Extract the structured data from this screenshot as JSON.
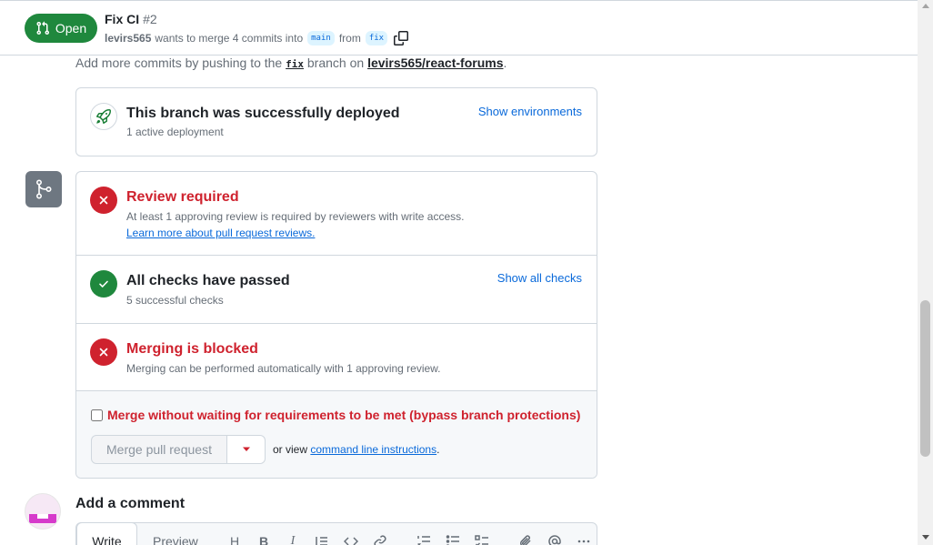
{
  "header": {
    "state": "Open",
    "title": "Fix CI",
    "number": "#2",
    "author": "levirs565",
    "meta_middle": "wants to merge 4 commits into",
    "base_branch": "main",
    "from_text": "from",
    "head_branch": "fix"
  },
  "commit_hint": {
    "prefix": "Add more commits by pushing to the",
    "branch": "fix",
    "middle": "branch on",
    "repo": "levirs565/react-forums",
    "suffix": "."
  },
  "deployment": {
    "title": "This branch was successfully deployed",
    "subtitle": "1 active deployment",
    "link": "Show environments"
  },
  "merge_box": {
    "review": {
      "title": "Review required",
      "subtitle": "At least 1 approving review is required by reviewers with write access.",
      "link": "Learn more about pull request reviews."
    },
    "checks": {
      "title": "All checks have passed",
      "subtitle": "5 successful checks",
      "link": "Show all checks"
    },
    "blocked": {
      "title": "Merging is blocked",
      "subtitle": "Merging can be performed automatically with 1 approving review."
    },
    "bypass_label": "Merge without waiting for requirements to be met (bypass branch protections)",
    "bypass_checked": false,
    "merge_button": "Merge pull request",
    "cli_prefix": "or view",
    "cli_link": "command line instructions",
    "cli_suffix": "."
  },
  "comment": {
    "heading": "Add a comment",
    "tab_write": "Write",
    "tab_preview": "Preview",
    "toolbar_heading": "H",
    "toolbar_bold": "B",
    "toolbar_italic": "I"
  },
  "colors": {
    "open_green": "#1f883d",
    "danger_red": "#cf222e",
    "link_blue": "#0969da",
    "muted_gray": "#656d76"
  }
}
